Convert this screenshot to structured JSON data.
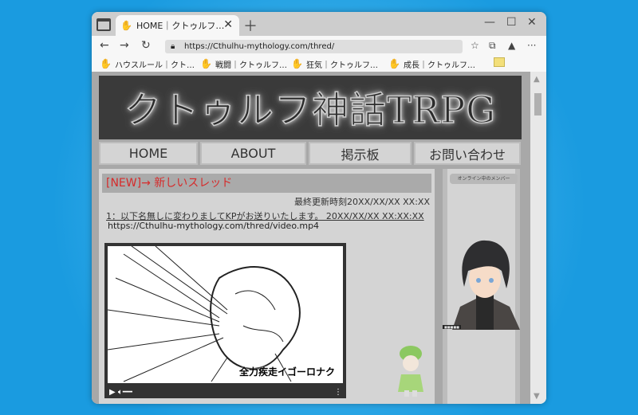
{
  "browser": {
    "tab_title": "HOME｜クトゥルフ…",
    "url": "https://Cthulhu-mythology.com/thred/",
    "bookmarks": [
      "ハウスルール｜クト…",
      "戦闘｜クトゥルフ…",
      "狂気｜クトゥルフ…",
      "成長｜クトゥルフ…"
    ]
  },
  "site": {
    "banner_title": "クトゥルフ神話TRPG",
    "nav": [
      "HOME",
      "ABOUT",
      "掲示板",
      "お問い合わせ"
    ],
    "thread": {
      "heading": "[NEW]→ 新しいスレッド",
      "updated": "最終更新時刻20XX/XX/XX XX:XX",
      "post_header": "1：以下名無しに変わりましてKPがお送りいたします。 20XX/XX/XX XX:XX:XX",
      "post_link": "https://Cthulhu-mythology.com/thred/video.mp4",
      "video_caption": "全力疾走イゴーロナク"
    },
    "sidebar": {
      "title": "オンライン中のメンバー"
    }
  },
  "colors": {
    "accent_red": "#d62b2b",
    "background_blue": "#1a9be0"
  }
}
